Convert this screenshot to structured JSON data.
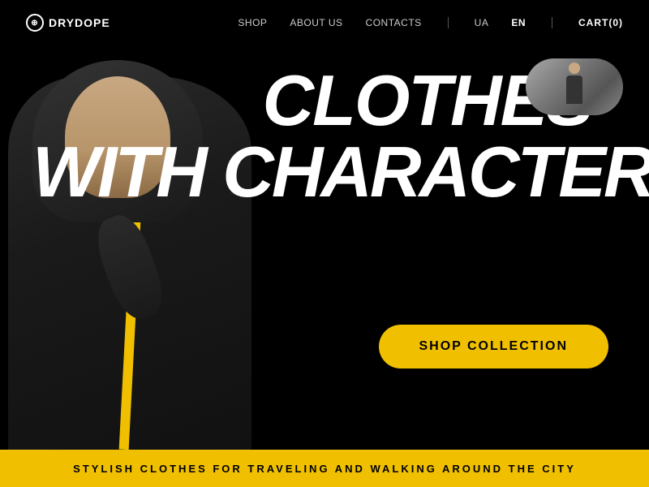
{
  "brand": {
    "name": "DRYDOPE",
    "logo_symbol": "⊕"
  },
  "nav": {
    "links": [
      {
        "label": "SHOP",
        "id": "shop"
      },
      {
        "label": "ABOUT US",
        "id": "about"
      },
      {
        "label": "CONTACTS",
        "id": "contacts"
      }
    ],
    "languages": [
      {
        "code": "UA",
        "active": false
      },
      {
        "code": "EN",
        "active": true
      }
    ],
    "cart_label": "CART(0)"
  },
  "hero": {
    "headline_line1": "CLOTHES",
    "headline_line2": "WITH CHARACTER",
    "cta_button": "SHOP COLLECTION"
  },
  "bottom_banner": {
    "text": "STYLISH CLOTHES FOR TRAVELING AND WALKING AROUND THE CITY"
  },
  "colors": {
    "accent": "#f0c000",
    "background": "#000000",
    "text_primary": "#ffffff"
  }
}
